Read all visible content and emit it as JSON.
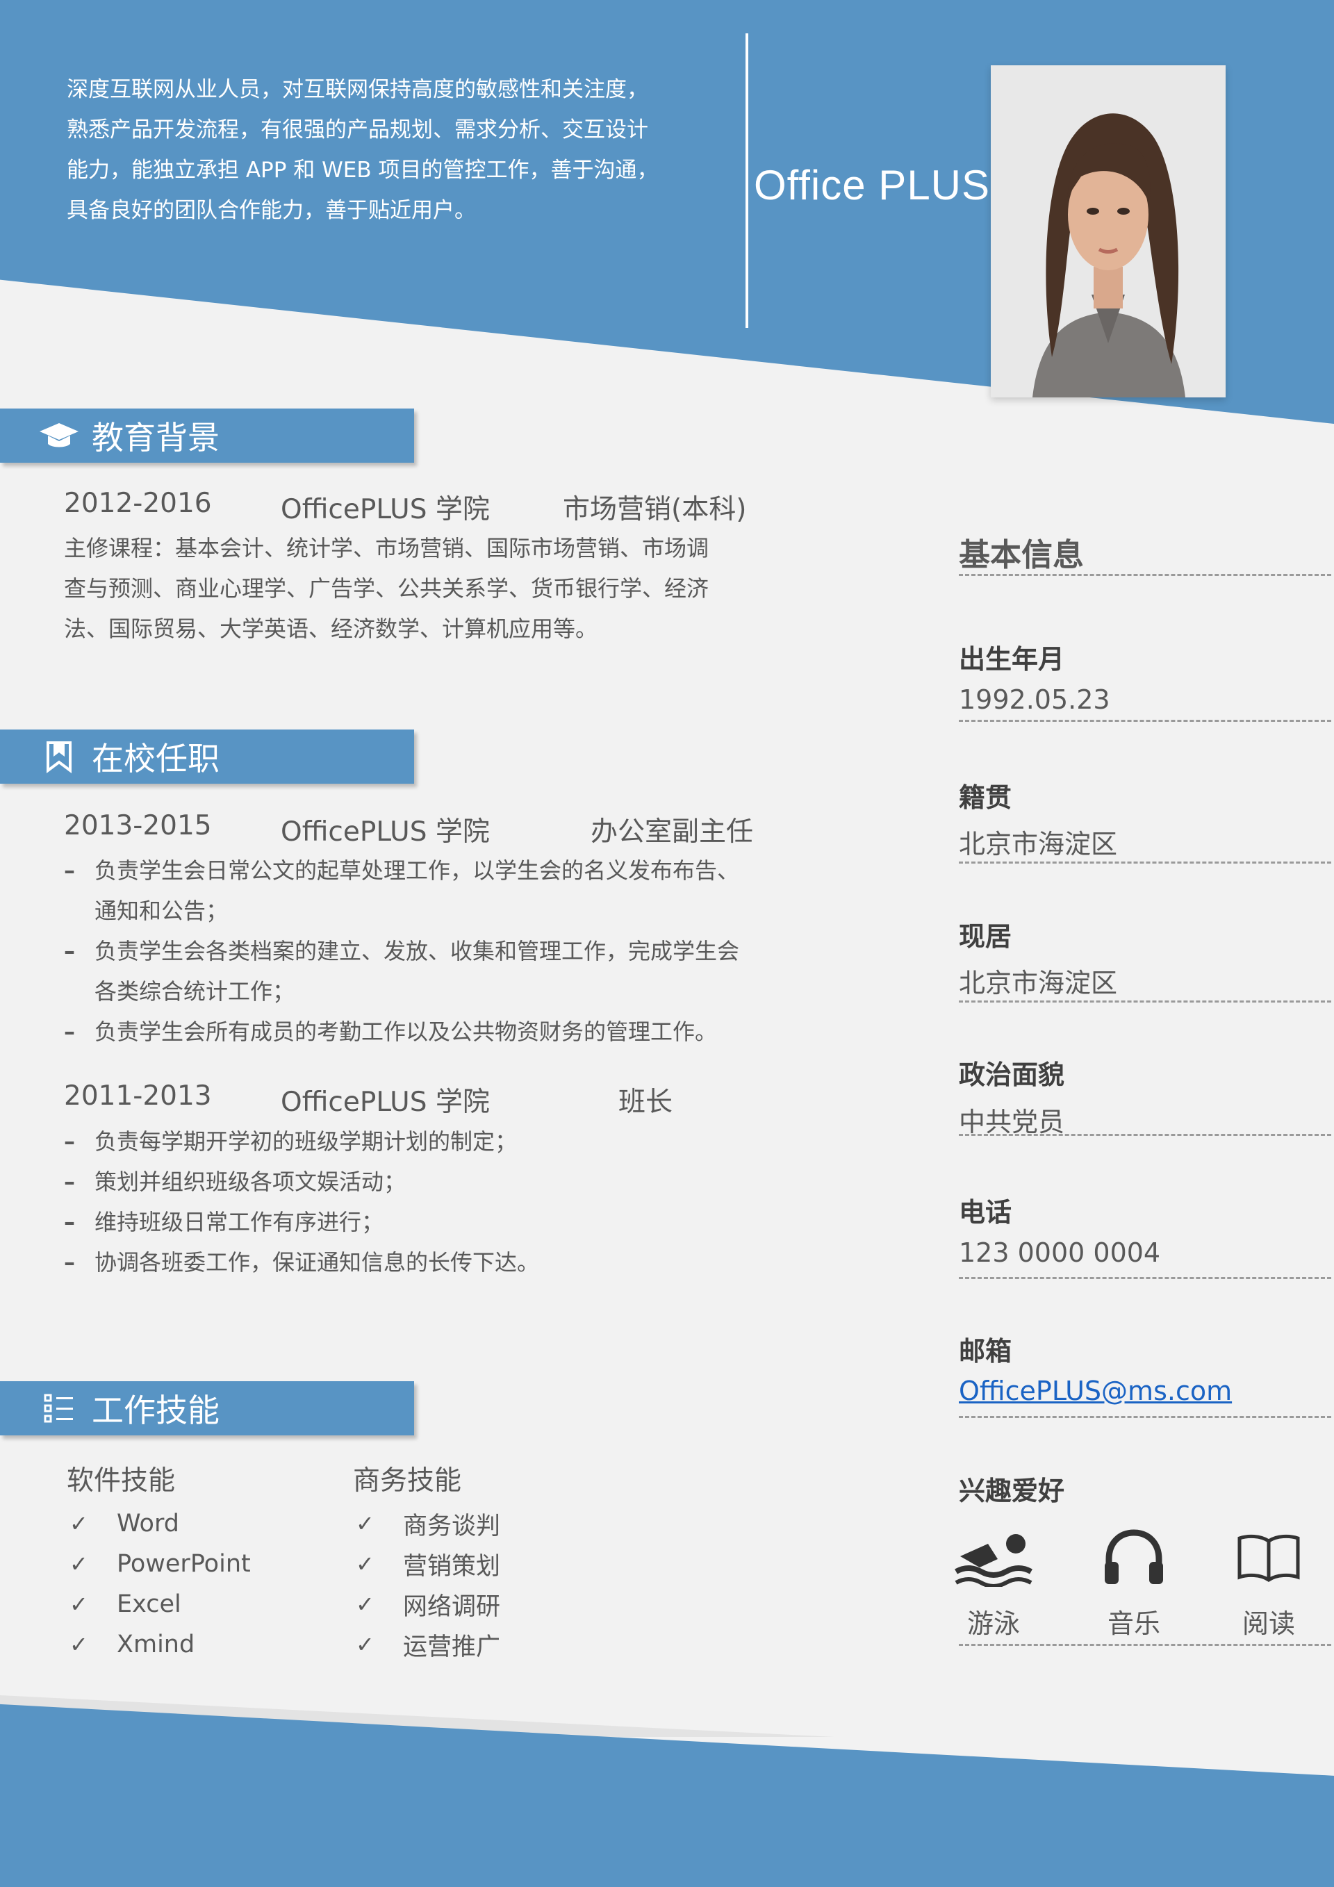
{
  "header": {
    "intro_lines": [
      "深度互联网从业人员，对互联网保持高度的敏感性和关注度，",
      "熟悉产品开发流程，有很强的产品规划、需求分析、交互设计",
      "能力，能独立承担 APP 和 WEB 项目的管控工作，善于沟通，",
      "具备良好的团队合作能力，善于贴近用户。"
    ],
    "name": "Office PLUS"
  },
  "education": {
    "title": "教育背景",
    "period": "2012-2016",
    "school": "OfficePLUS 学院",
    "major": "市场营销(本科)",
    "course_lines": [
      "主修课程：基本会计、统计学、市场营销、国际市场营销、市场调",
      "查与预测、商业心理学、广告学、公共关系学、货币银行学、经济",
      "法、国际贸易、大学英语、经济数学、计算机应用等。"
    ]
  },
  "campus": {
    "title": "在校任职",
    "entries": [
      {
        "period": "2013-2015",
        "org": "OfficePLUS 学院",
        "role": "办公室副主任",
        "items": [
          "负责学生会日常公文的起草处理工作，以学生会的名义发布布告、通知和公告；",
          "负责学生会各类档案的建立、发放、收集和管理工作，完成学生会各类综合统计工作；",
          "负责学生会所有成员的考勤工作以及公共物资财务的管理工作。"
        ]
      },
      {
        "period": "2011-2013",
        "org": "OfficePLUS 学院",
        "role": "班长",
        "items": [
          "负责每学期开学初的班级学期计划的制定；",
          "策划并组织班级各项文娱活动；",
          "维持班级日常工作有序进行；",
          "协调各班委工作，保证通知信息的长传下达。"
        ]
      }
    ]
  },
  "skills": {
    "title": "工作技能",
    "check": "✓",
    "software_title": "软件技能",
    "software": [
      "Word",
      "PowerPoint",
      "Excel",
      "Xmind"
    ],
    "business_title": "商务技能",
    "business": [
      "商务谈判",
      "营销策划",
      "网络调研",
      "运营推广"
    ]
  },
  "info": {
    "title": "基本信息",
    "birth_label": "出生年月",
    "birth": "1992.05.23",
    "origin_label": "籍贯",
    "origin": "北京市海淀区",
    "residence_label": "现居",
    "residence": "北京市海淀区",
    "politics_label": "政治面貌",
    "politics": "中共党员",
    "phone_label": "电话",
    "phone": "123 0000 0004",
    "email_label": "邮箱",
    "email": "OfficePLUS@ms.com",
    "hobby_label": "兴趣爱好",
    "hobbies": [
      {
        "label": "游泳",
        "icon": "swimming-icon"
      },
      {
        "label": "音乐",
        "icon": "headphones-icon"
      },
      {
        "label": "阅读",
        "icon": "book-icon"
      }
    ]
  },
  "colors": {
    "accent": "#5894c4",
    "background": "#f2f2f2",
    "link": "#1a63c4"
  }
}
